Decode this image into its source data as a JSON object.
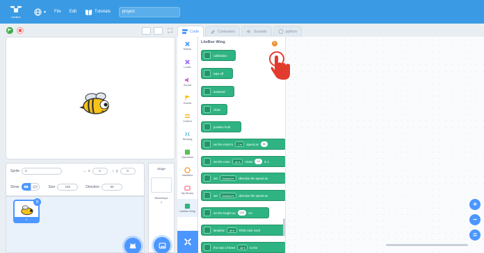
{
  "menubar": {
    "logo_text": "LiteBee",
    "file_label": "File",
    "edit_label": "Edit",
    "tutorials_label": "Tutorials",
    "project_title": "project",
    "bar_color": "#3a9be4"
  },
  "sprite_info": {
    "sprite_label": "Sprite",
    "sprite_name": "0",
    "x_label": "x",
    "x_value": "0",
    "y_label": "y",
    "y_value": "0",
    "show_label": "Show",
    "size_label": "Size",
    "size_value": "100",
    "direction_label": "Direction",
    "direction_value": "90"
  },
  "sprite_list": {
    "items": [
      {
        "name": "0",
        "badge": "8"
      }
    ]
  },
  "stage_pane": {
    "title": "Stage",
    "backdrops_label": "Backdrops",
    "backdrops_count": "1"
  },
  "tabs": [
    {
      "label": "Code",
      "icon": "code-icon",
      "active": true
    },
    {
      "label": "Costumes",
      "icon": "brush-icon",
      "active": false
    },
    {
      "label": "Sounds",
      "icon": "speaker-icon",
      "active": false
    },
    {
      "label": "python",
      "icon": "python-icon",
      "active": false
    }
  ],
  "categories": [
    {
      "label": "Motion",
      "color": "#4c97ff"
    },
    {
      "label": "Looks",
      "color": "#9966ff"
    },
    {
      "label": "Sound",
      "color": "#cf63cf"
    },
    {
      "label": "Events",
      "color": "#ffbf00"
    },
    {
      "label": "Control",
      "color": "#ffab19"
    },
    {
      "label": "Sensing",
      "color": "#5cb1d6"
    },
    {
      "label": "Operators",
      "color": "#59c059"
    },
    {
      "label": "Variables",
      "color": "#ff8c1a"
    },
    {
      "label": "My Blocks",
      "color": "#ff6680"
    },
    {
      "label": "LiteBee Wing",
      "color": "#2fb382"
    }
  ],
  "palette": {
    "title": "LiteBee Wing",
    "info_badge": "!",
    "blocks": [
      {
        "parts": [
          {
            "t": "text",
            "v": "calibration"
          }
        ]
      },
      {
        "parts": [
          {
            "t": "text",
            "v": "take off"
          }
        ]
      },
      {
        "parts": [
          {
            "t": "text",
            "v": "autoland"
          }
        ]
      },
      {
        "parts": [
          {
            "t": "text",
            "v": "close"
          }
        ]
      },
      {
        "parts": [
          {
            "t": "text",
            "v": "position hold"
          }
        ]
      },
      {
        "parts": [
          {
            "t": "text",
            "v": "set the motor's"
          },
          {
            "t": "dd",
            "v": "1 ▾"
          },
          {
            "t": "text",
            "v": "speed as"
          },
          {
            "t": "pill",
            "v": "50"
          }
        ]
      },
      {
        "parts": [
          {
            "t": "text",
            "v": "set the rover"
          },
          {
            "t": "dd",
            "v": "au ▾"
          },
          {
            "t": "text",
            "v": "rotate"
          },
          {
            "t": "pill",
            "v": "10"
          },
          {
            "t": "text",
            "v": "in s"
          }
        ]
      },
      {
        "parts": [
          {
            "t": "text",
            "v": "set"
          },
          {
            "t": "dd",
            "v": "forward ▾"
          },
          {
            "t": "text",
            "v": "direction the speed as"
          }
        ]
      },
      {
        "parts": [
          {
            "t": "text",
            "v": "set"
          },
          {
            "t": "dd",
            "v": "forward ▾"
          },
          {
            "t": "text",
            "v": "direction the speed as"
          }
        ]
      },
      {
        "parts": [
          {
            "t": "text",
            "v": "set the height as"
          },
          {
            "t": "pill",
            "v": "100"
          },
          {
            "t": "text",
            "v": "cm"
          }
        ]
      },
      {
        "parts": [
          {
            "t": "text",
            "v": "lamplow"
          },
          {
            "t": "dd",
            "v": "all ▾"
          },
          {
            "t": "text",
            "v": "RGB color each"
          }
        ]
      },
      {
        "parts": [
          {
            "t": "text",
            "v": "the rotor of bees"
          },
          {
            "t": "dd",
            "v": "all ▾"
          },
          {
            "t": "text",
            "v": "to the"
          }
        ]
      }
    ]
  },
  "zoom_controls": {
    "zoom_in": "+",
    "zoom_out": "−",
    "reset": "="
  },
  "accent_color": "#4c97ff",
  "block_color": "#2fb382"
}
